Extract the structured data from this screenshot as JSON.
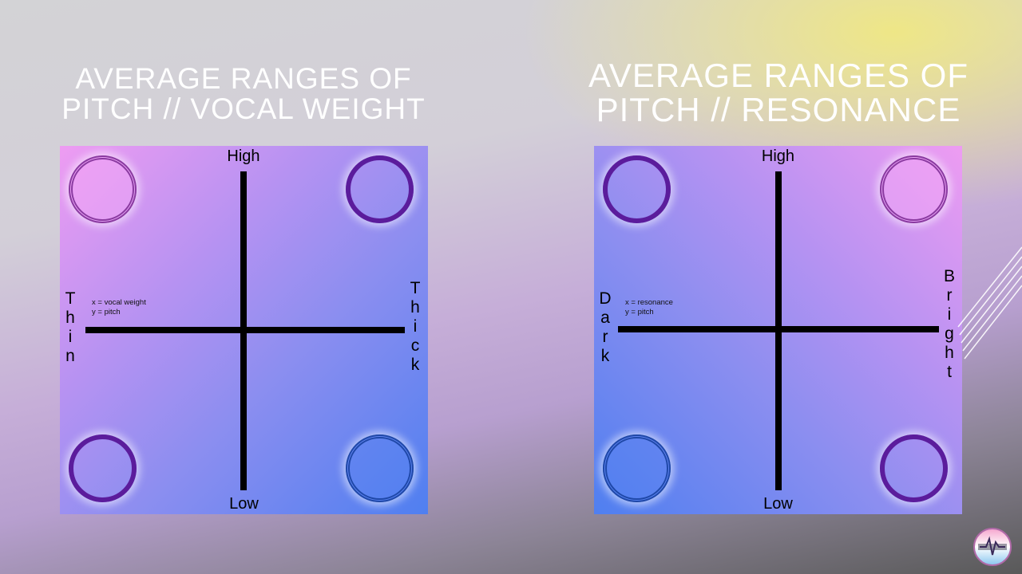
{
  "slide": {
    "left_title": [
      "AVERAGE RANGES OF",
      "PITCH // VOCAL WEIGHT"
    ],
    "right_title": [
      "AVERAGE RANGES OF",
      "PITCH // RESONANCE"
    ]
  },
  "left_chart": {
    "top_label": "High",
    "bottom_label": "Low",
    "left_label": "Thin",
    "right_label": "Thick",
    "note_x": "x = vocal weight",
    "note_y": "y = pitch",
    "colors": {
      "top_left": "#f0a6f4",
      "bottom_right": "#4f7ff0",
      "ring": "#5b1c9c"
    }
  },
  "right_chart": {
    "top_label": "High",
    "bottom_label": "Low",
    "left_label": "Dark",
    "right_label": "Bright",
    "note_x": "x = resonance",
    "note_y": "y = pitch",
    "colors": {
      "top_right": "#f0a6f4",
      "bottom_left": "#4f7ff0",
      "ring": "#5b1c9c"
    }
  },
  "icons": {
    "logo": "channel-logo-icon",
    "decoration": "diagonal-lines-icon"
  }
}
